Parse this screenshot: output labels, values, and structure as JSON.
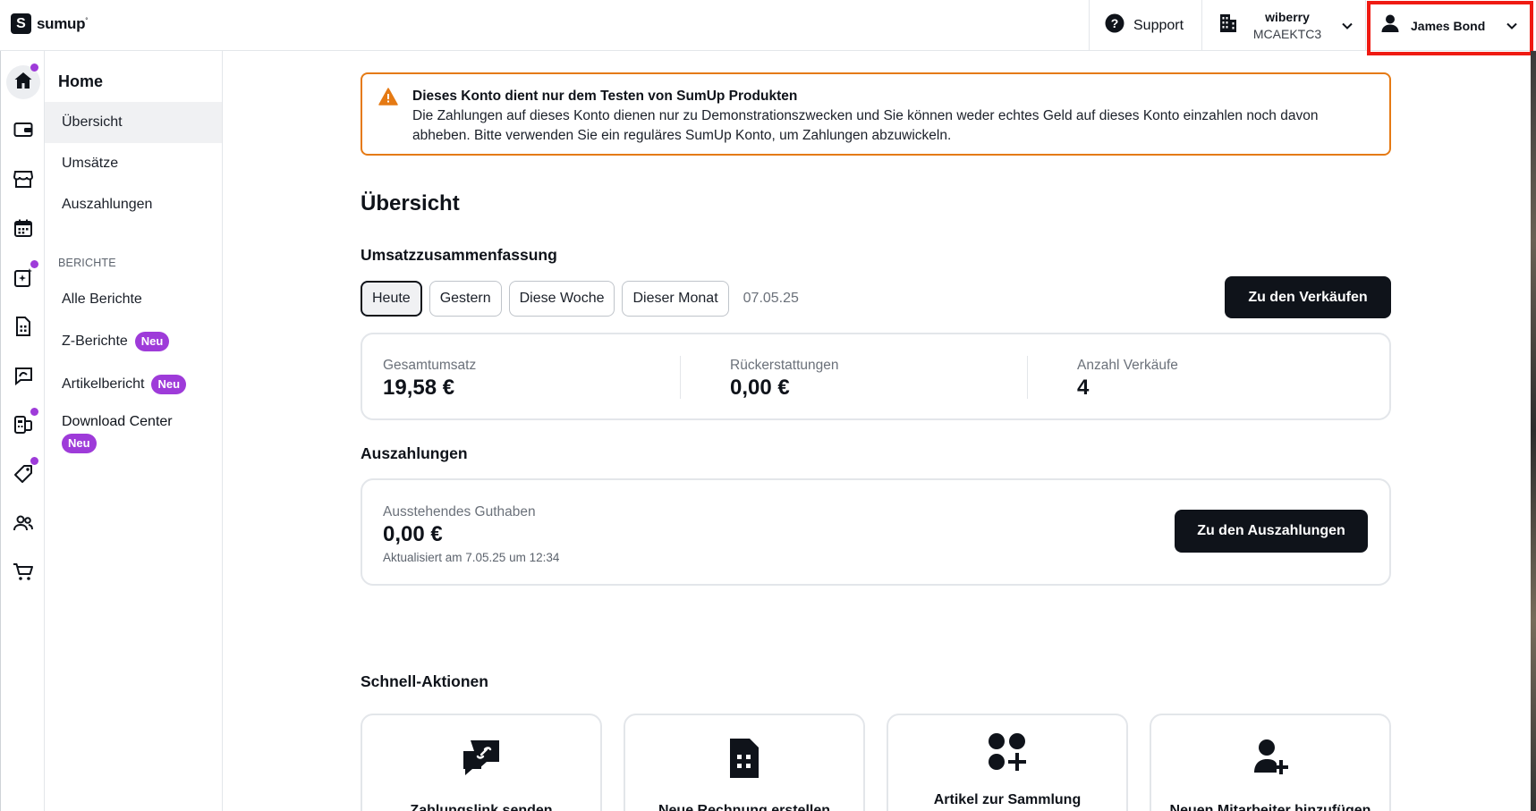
{
  "brand": {
    "name": "sumup",
    "mark": "S"
  },
  "topbar": {
    "support_label": "Support",
    "merchant_name": "wiberry",
    "merchant_code": "MCAEKTC3",
    "user_name": "James Bond",
    "highlight_color": "#ef1a12"
  },
  "rail": {
    "items": [
      {
        "icon": "home-icon",
        "active": true,
        "dot": true
      },
      {
        "icon": "wallet-icon",
        "active": false,
        "dot": false
      },
      {
        "icon": "store-icon",
        "active": false,
        "dot": false
      },
      {
        "icon": "calendar-icon",
        "active": false,
        "dot": false
      },
      {
        "icon": "sparkle-report-icon",
        "active": false,
        "dot": true
      },
      {
        "icon": "invoice-icon",
        "active": false,
        "dot": false
      },
      {
        "icon": "payment-link-icon",
        "active": false,
        "dot": false
      },
      {
        "icon": "devices-icon",
        "active": false,
        "dot": true
      },
      {
        "icon": "tag-icon",
        "active": false,
        "dot": true
      },
      {
        "icon": "team-icon",
        "active": false,
        "dot": false
      },
      {
        "icon": "cart-icon",
        "active": false,
        "dot": false
      }
    ],
    "dot_color": "#9e3bd9"
  },
  "sidebar": {
    "title": "Home",
    "items": [
      {
        "label": "Übersicht",
        "active": true
      },
      {
        "label": "Umsätze"
      },
      {
        "label": "Auszahlungen"
      }
    ],
    "section_label": "BERICHTE",
    "reports": [
      {
        "label": "Alle Berichte"
      },
      {
        "label": "Z-Berichte",
        "badge": "Neu"
      },
      {
        "label": "Artikelbericht",
        "badge": "Neu"
      }
    ],
    "download_center": {
      "label": "Download Center",
      "badge": "Neu"
    }
  },
  "alert": {
    "title": "Dieses Konto dient nur dem Testen von SumUp Produkten",
    "body": "Die Zahlungen auf dieses Konto dienen nur zu Demonstrationszwecken und Sie können weder echtes Geld auf dieses Konto einzahlen noch davon abheben. Bitte verwenden Sie ein reguläres SumUp Konto, um Zahlungen abzuwickeln.",
    "color": "#e57a14"
  },
  "main": {
    "title": "Übersicht",
    "summary": {
      "heading": "Umsatzzusammenfassung",
      "filters": [
        "Heute",
        "Gestern",
        "Diese Woche",
        "Dieser Monat"
      ],
      "selected_filter": "Heute",
      "date": "07.05.25",
      "cta": "Zu den Verkäufen",
      "stats": [
        {
          "label": "Gesamtumsatz",
          "value": "19,58 €"
        },
        {
          "label": "Rückerstattungen",
          "value": "0,00 €"
        },
        {
          "label": "Anzahl Verkäufe",
          "value": "4"
        }
      ]
    },
    "payouts": {
      "heading": "Auszahlungen",
      "label": "Ausstehendes Guthaben",
      "value": "0,00 €",
      "updated": "Aktualisiert am 7.05.25 um 12:34",
      "cta": "Zu den Auszahlungen"
    },
    "quick_actions": {
      "heading": "Schnell-Aktionen",
      "items": [
        {
          "label": "Zahlungslink senden",
          "icon": "chat-link-icon"
        },
        {
          "label": "Neue Rechnung erstellen",
          "icon": "invoice-doc-icon"
        },
        {
          "label": "Artikel zur Sammlung hinzufügen",
          "icon": "add-item-icon"
        },
        {
          "label": "Neuen Mitarbeiter hinzufügen",
          "icon": "add-person-icon"
        }
      ]
    }
  }
}
